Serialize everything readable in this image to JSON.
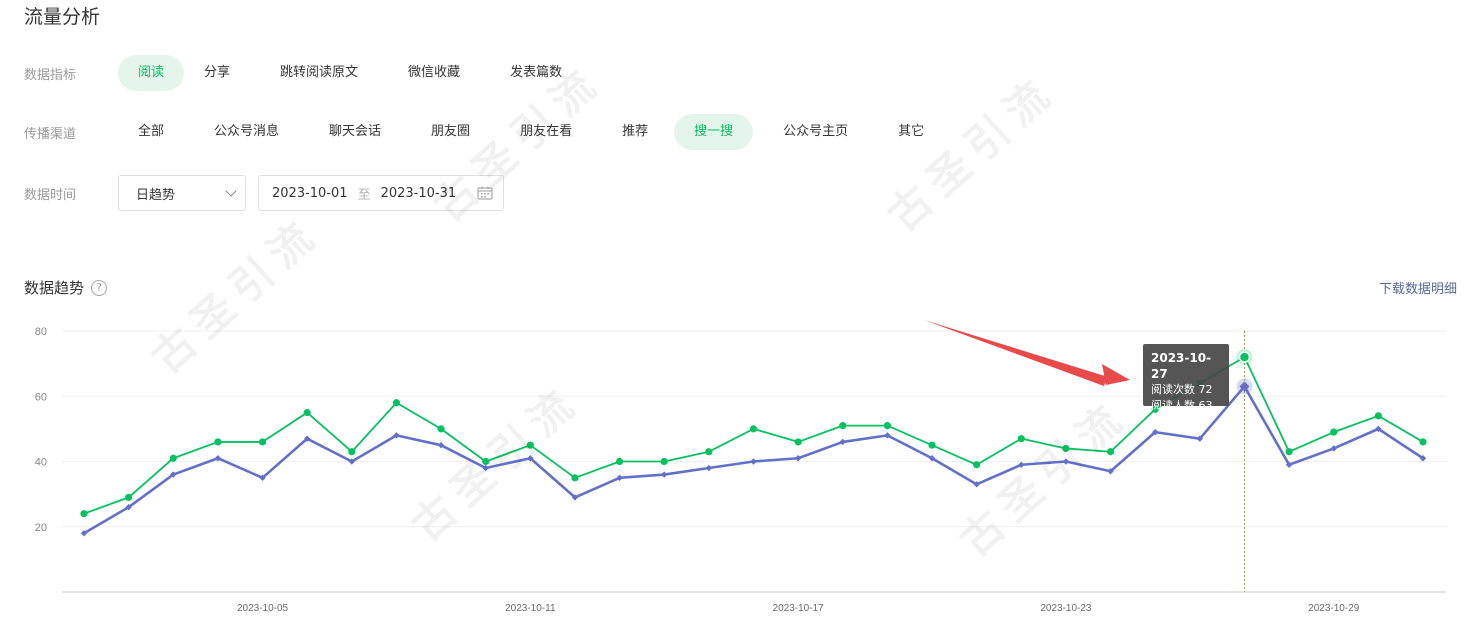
{
  "page_title": "流量分析",
  "metrics": {
    "label": "数据指标",
    "items": [
      "阅读",
      "分享",
      "跳转阅读原文",
      "微信收藏",
      "发表篇数"
    ],
    "active": 0
  },
  "channels": {
    "label": "传播渠道",
    "items": [
      "全部",
      "公众号消息",
      "聊天会话",
      "朋友圈",
      "朋友在看",
      "推荐",
      "搜一搜",
      "公众号主页",
      "其它"
    ],
    "active": 6
  },
  "time": {
    "label": "数据时间",
    "granularity": "日趋势",
    "start": "2023-10-01",
    "separator": "至",
    "end": "2023-10-31"
  },
  "trend": {
    "title": "数据趋势",
    "help_glyph": "?",
    "download": "下载数据明细"
  },
  "watermark_text": "古圣引流",
  "colors": {
    "accent": "#07c160",
    "series_reads": "#07c160",
    "series_readers": "#6470c8",
    "annotation_arrow": "#e84a4a"
  },
  "tooltip": {
    "date": "2023-10-27",
    "lines": [
      "阅读次数 72",
      "阅读人数 63"
    ]
  },
  "chart_data": {
    "type": "line",
    "x": [
      "2023-10-01",
      "2023-10-02",
      "2023-10-03",
      "2023-10-04",
      "2023-10-05",
      "2023-10-06",
      "2023-10-07",
      "2023-10-08",
      "2023-10-09",
      "2023-10-10",
      "2023-10-11",
      "2023-10-12",
      "2023-10-13",
      "2023-10-14",
      "2023-10-15",
      "2023-10-16",
      "2023-10-17",
      "2023-10-18",
      "2023-10-19",
      "2023-10-20",
      "2023-10-21",
      "2023-10-22",
      "2023-10-23",
      "2023-10-24",
      "2023-10-25",
      "2023-10-26",
      "2023-10-27",
      "2023-10-28",
      "2023-10-29",
      "2023-10-30",
      "2023-10-31"
    ],
    "series": [
      {
        "name": "阅读次数",
        "values": [
          24,
          29,
          41,
          46,
          46,
          55,
          43,
          58,
          50,
          40,
          45,
          35,
          40,
          40,
          43,
          50,
          46,
          51,
          51,
          45,
          39,
          47,
          44,
          43,
          56,
          64,
          72,
          43,
          49,
          54,
          46
        ]
      },
      {
        "name": "阅读人数",
        "values": [
          18,
          26,
          36,
          41,
          35,
          47,
          40,
          48,
          45,
          38,
          41,
          29,
          35,
          36,
          38,
          40,
          41,
          46,
          48,
          41,
          33,
          39,
          40,
          37,
          49,
          47,
          63,
          39,
          44,
          50,
          41
        ]
      }
    ],
    "x_ticks": [
      "2023-10-05",
      "2023-10-11",
      "2023-10-17",
      "2023-10-23",
      "2023-10-29"
    ],
    "y_ticks": [
      20,
      40,
      60,
      80
    ],
    "ylim": [
      0,
      80
    ],
    "grid": true,
    "legend": "none",
    "highlighted_x": "2023-10-27"
  }
}
